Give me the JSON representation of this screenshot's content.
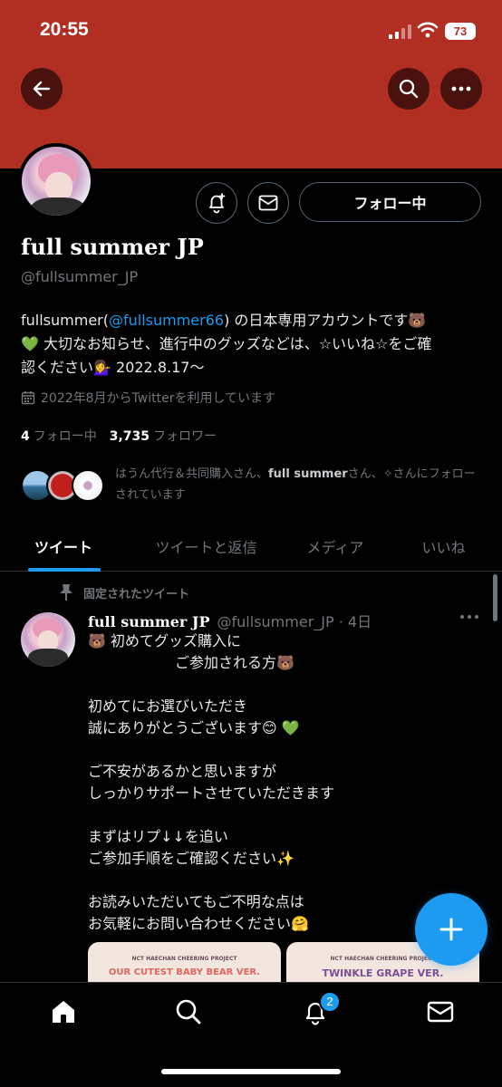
{
  "status_bar": {
    "time": "20:55",
    "battery": "73"
  },
  "header": {
    "banner_color": "#b02f22"
  },
  "profile": {
    "follow_label": "フォロー中",
    "display_name": "full summer JP",
    "handle": "@fullsummer_JP",
    "bio": {
      "line1_pre": "fullsummer(",
      "line1_link": "@fullsummer66",
      "line1_post": ") の日本専用アカウントです🐻",
      "line2": "💚 大切なお知らせ、進行中のグッズなどは、☆いいね☆をご確",
      "line3": "認ください💁‍♀️ 2022.8.17～"
    },
    "joined": "2022年8月からTwitterを利用しています",
    "following_count": "4",
    "following_label": "フォロー中",
    "followers_count": "3,735",
    "followers_label": "フォロワー",
    "followed_by": {
      "pre": "はうん代行＆共同購入さん、",
      "bold": "full summer",
      "post": "さん、✧さんにフォローされています"
    }
  },
  "tabs": [
    {
      "label": "ツイート",
      "active": true
    },
    {
      "label": "ツイートと返信",
      "active": false
    },
    {
      "label": "メディア",
      "active": false
    },
    {
      "label": "いいね",
      "active": false
    }
  ],
  "tweet": {
    "pinned_label": "固定されたツイート",
    "author_name": "full summer JP",
    "author_meta": "@fullsummer_JP · 4日",
    "body": "🐻 初めてグッズ購入に\n　　　　　　ご参加される方🐻\n\n初めてにお選びいただき\n誠にありがとうございます😊 💚\n\nご不安があるかと思いますが\nしっかりサポートさせていただきます\n\nまずはリプ↓↓を追い\nご参加手順をご確認ください✨\n\nお読みいただいてもご不明な点は\nお気軽にお問い合わせください🤗",
    "media": [
      {
        "small": "NCT HAECHAN CHEERING PROJECT",
        "big": "OUR CUTEST BABY BEAR VER."
      },
      {
        "small": "NCT HAECHAN CHEERING PROJECT",
        "big": "TWINKLE GRAPE VER."
      }
    ]
  },
  "nav": {
    "notification_badge": "2"
  },
  "colors": {
    "accent": "#1d9bf0",
    "muted": "#71767b",
    "background": "#000000"
  },
  "icons": [
    "back-arrow-icon",
    "search-icon",
    "more-icon",
    "bell-plus-icon",
    "mail-icon",
    "calendar-icon",
    "pin-icon",
    "compose-plus-icon",
    "home-icon",
    "bell-icon"
  ]
}
